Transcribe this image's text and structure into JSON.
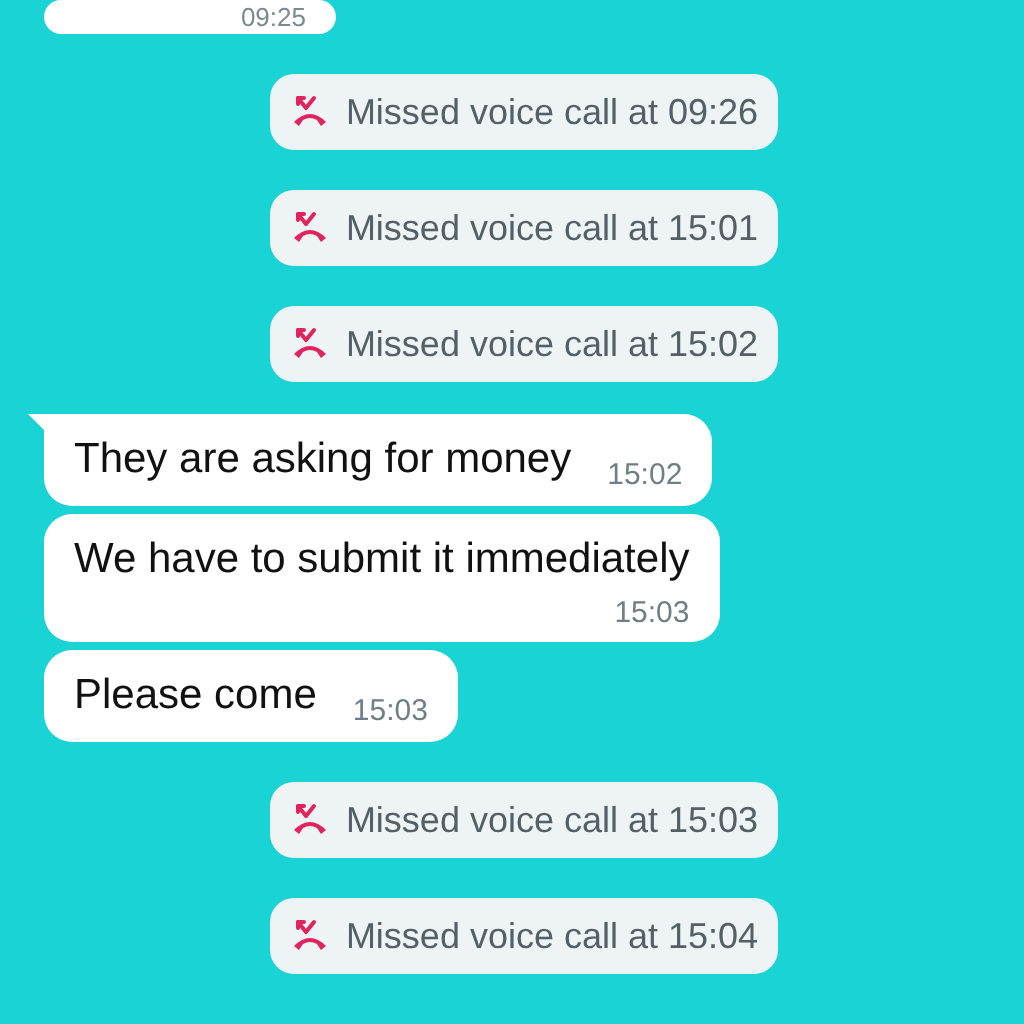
{
  "messages": [
    {
      "kind": "time_only",
      "time": "09:25"
    },
    {
      "kind": "missed_call",
      "text": "Missed voice call at 09:26"
    },
    {
      "kind": "missed_call",
      "text": "Missed voice call at 15:01"
    },
    {
      "kind": "missed_call",
      "text": "Missed voice call at 15:02"
    },
    {
      "kind": "message",
      "text": "They are asking for money",
      "time": "15:02",
      "tail": true
    },
    {
      "kind": "long_message",
      "text": "We have to submit it immediately",
      "time": "15:03",
      "tail": false
    },
    {
      "kind": "message",
      "text": "Please come",
      "time": "15:03",
      "tail": false
    },
    {
      "kind": "missed_call",
      "text": "Missed voice call at 15:03"
    },
    {
      "kind": "missed_call",
      "text": "Missed voice call at 15:04"
    }
  ]
}
